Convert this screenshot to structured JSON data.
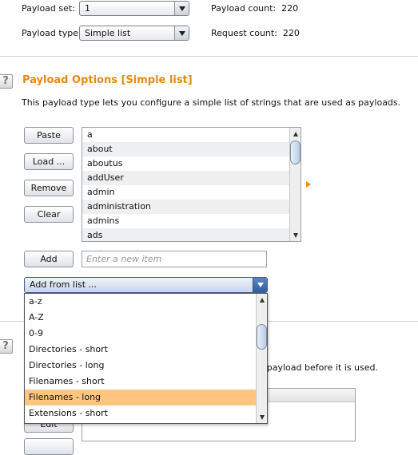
{
  "top": {
    "payload_set_label": "Payload set:",
    "payload_set_value": "1",
    "payload_type_label": "Payload type:",
    "payload_type_value": "Simple list",
    "payload_count_label": "Payload count:",
    "payload_count_value": "220",
    "request_count_label": "Request count:",
    "request_count_value": "220"
  },
  "options": {
    "help_glyph": "?",
    "title": "Payload Options [Simple list]",
    "description": "This payload type lets you configure a simple list of strings that are used as payloads.",
    "buttons": {
      "paste": "Paste",
      "load": "Load ...",
      "remove": "Remove",
      "clear": "Clear",
      "add": "Add"
    },
    "list_items": [
      "a",
      "about",
      "aboutus",
      "addUser",
      "admin",
      "administration",
      "admins",
      "ads"
    ],
    "new_item_placeholder": "Enter a new item",
    "add_from_list": "Add from list ..."
  },
  "dropdown": {
    "options": [
      "a-z",
      "A-Z",
      "0-9",
      "Directories - short",
      "Directories - long",
      "Filenames - short",
      "Filenames - long",
      "Extensions - short"
    ],
    "selected": "Filenames - long"
  },
  "processing": {
    "help_glyph": "?",
    "partial_text": "ach payload before it is used.",
    "partial_button": "Edit"
  },
  "colors": {
    "section_title": "#e58a12",
    "highlight": "#ffc682",
    "accent_arrow": "#f08c00"
  }
}
